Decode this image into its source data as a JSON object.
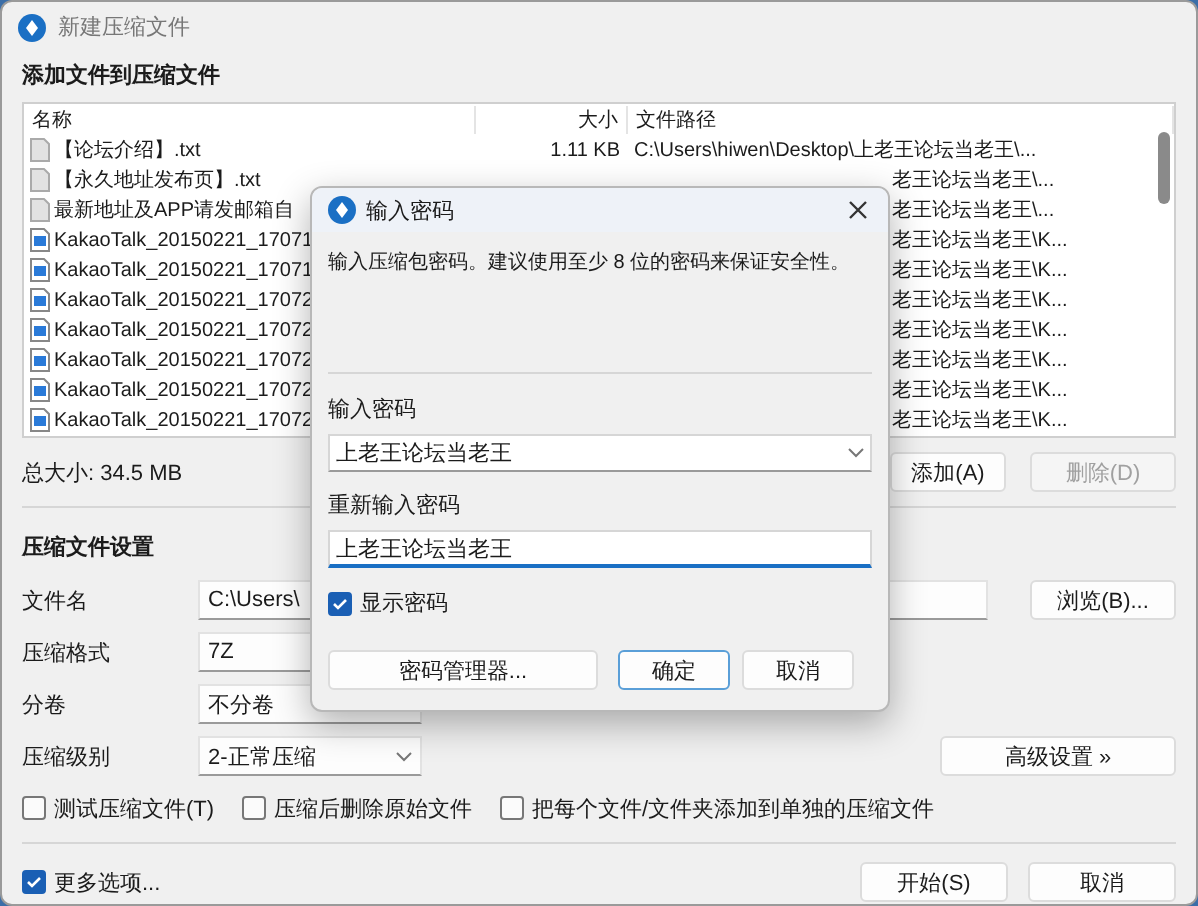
{
  "window": {
    "title": "新建压缩文件",
    "section_title": "添加文件到压缩文件"
  },
  "file_list": {
    "columns": [
      "名称",
      "大小",
      "文件路径"
    ],
    "rows": [
      {
        "kind": "text",
        "name": "【论坛介绍】.txt",
        "size": "1.11 KB",
        "path": "C:\\Users\\hiwen\\Desktop\\上老王论坛当老王\\..."
      },
      {
        "kind": "text",
        "name": "【永久地址发布页】.txt",
        "path": "老王论坛当老王\\..."
      },
      {
        "kind": "text",
        "name": "最新地址及APP请发邮箱自",
        "path": "老王论坛当老王\\..."
      },
      {
        "kind": "image",
        "name": "KakaoTalk_20150221_17071",
        "path": "老王论坛当老王\\K..."
      },
      {
        "kind": "image",
        "name": "KakaoTalk_20150221_17071",
        "path": "老王论坛当老王\\K..."
      },
      {
        "kind": "image",
        "name": "KakaoTalk_20150221_17072",
        "path": "老王论坛当老王\\K..."
      },
      {
        "kind": "image",
        "name": "KakaoTalk_20150221_17072",
        "path": "老王论坛当老王\\K..."
      },
      {
        "kind": "image",
        "name": "KakaoTalk_20150221_17072",
        "path": "老王论坛当老王\\K..."
      },
      {
        "kind": "image",
        "name": "KakaoTalk_20150221_17072",
        "path": "老王论坛当老王\\K..."
      },
      {
        "kind": "image",
        "name": "KakaoTalk_20150221_17072",
        "path": "老王论坛当老王\\K..."
      }
    ]
  },
  "total_size": "总大小: 34.5 MB",
  "list_buttons": [
    {
      "label": "添加(A)",
      "disabled": false
    },
    {
      "label": "删除(D)",
      "disabled": true
    }
  ],
  "settings": {
    "title": "压缩文件设置",
    "fields": [
      {
        "kind": "text",
        "label": "文件名",
        "value": "C:\\Users\\"
      },
      {
        "kind": "select",
        "label": "压缩格式",
        "value": "7Z"
      },
      {
        "kind": "select",
        "label": "分卷",
        "value": "不分卷"
      },
      {
        "kind": "select",
        "label": "压缩级别",
        "value": "2-正常压缩"
      }
    ],
    "browse_button": "浏览(B)...",
    "advanced_button": "高级设置 »",
    "options": [
      {
        "label": "测试压缩文件(T)",
        "checked": false
      },
      {
        "label": "压缩后删除原始文件",
        "checked": false
      },
      {
        "label": "把每个文件/文件夹添加到单独的压缩文件",
        "checked": false
      }
    ]
  },
  "more_options": {
    "label": "更多选项...",
    "checked": true
  },
  "footer_buttons": [
    "开始(S)",
    "取消"
  ],
  "dialog": {
    "title": "输入密码",
    "hint": "输入压缩包密码。建议使用至少 8 位的密码来保证安全性。",
    "password_label": "输入密码",
    "password_value": "上老王论坛当老王",
    "confirm_label": "重新输入密码",
    "confirm_value": "上老王论坛当老王",
    "show_password": {
      "label": "显示密码",
      "checked": true
    },
    "buttons": [
      {
        "label": "密码管理器...",
        "default": false
      },
      {
        "label": "确定",
        "default": true
      },
      {
        "label": "取消",
        "default": false
      }
    ]
  }
}
